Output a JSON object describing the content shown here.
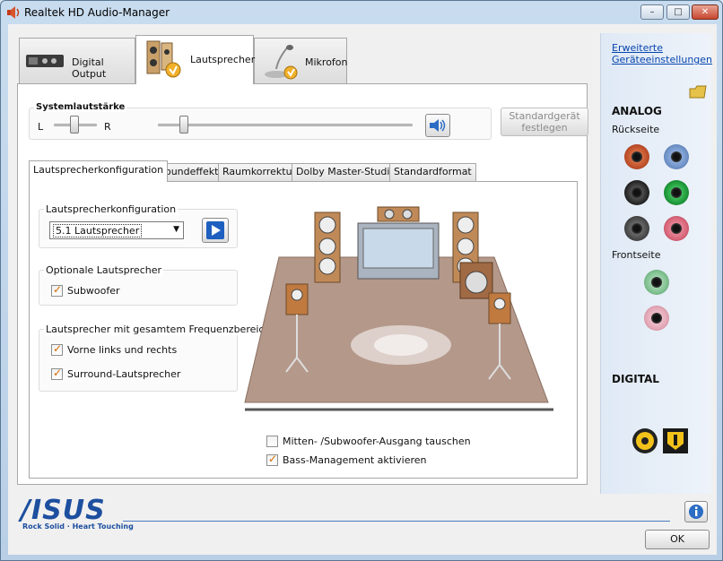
{
  "window": {
    "title": "Realtek HD Audio-Manager",
    "minimize": "–",
    "maximize": "□",
    "close": "✕"
  },
  "tabs": [
    {
      "label": "Digital Output",
      "icon": "digital-output-device-icon",
      "active": false
    },
    {
      "label": "Lautsprecher",
      "icon": "speakers-icon",
      "active": true
    },
    {
      "label": "Mikrofon",
      "icon": "microphone-icon",
      "active": false
    }
  ],
  "volume": {
    "title": "Systemlautstärke",
    "left_label": "L",
    "right_label": "R",
    "speaker_icon": "speaker-volume-icon",
    "default_button": "Standardgerät festlegen"
  },
  "subtabs": [
    {
      "label": "Lautsprecherkonfiguration",
      "active": true
    },
    {
      "label": "Soundeffekt",
      "active": false
    },
    {
      "label": "Raumkorrektur",
      "active": false
    },
    {
      "label": "Dolby Master-Studio",
      "active": false
    },
    {
      "label": "Standardformat",
      "active": false
    }
  ],
  "config": {
    "legend": "Lautsprecherkonfiguration",
    "selected": "5.1 Lautsprecher",
    "play_icon": "play-icon"
  },
  "optional": {
    "legend": "Optionale Lautsprecher",
    "subwoofer": "Subwoofer"
  },
  "fullrange": {
    "legend": "Lautsprecher mit gesamtem Frequenzbereich",
    "front": "Vorne links und rechts",
    "surround": "Surround-Lautsprecher"
  },
  "options": {
    "swap": "Mitten- /Subwoofer-Ausgang tauschen",
    "bass": "Bass-Management aktivieren"
  },
  "right_panel": {
    "advanced_link": "Erweiterte Geräteeinstellungen",
    "analog": "ANALOG",
    "rear": "Rückseite",
    "front": "Frontseite",
    "digital": "DIGITAL",
    "jack_colors": {
      "orange": "#c0502a",
      "blue": "#6f93c9",
      "black": "#2a2a2a",
      "green": "#1f9a3a",
      "gray": "#4a4a4a",
      "pink": "#d9667a",
      "front_green": "#7fc08f",
      "front_pink": "#e3a7b6"
    }
  },
  "footer": {
    "brand": "/ISUS",
    "tagline": "Rock Solid · Heart Touching",
    "info_icon": "info-icon",
    "ok": "OK"
  }
}
